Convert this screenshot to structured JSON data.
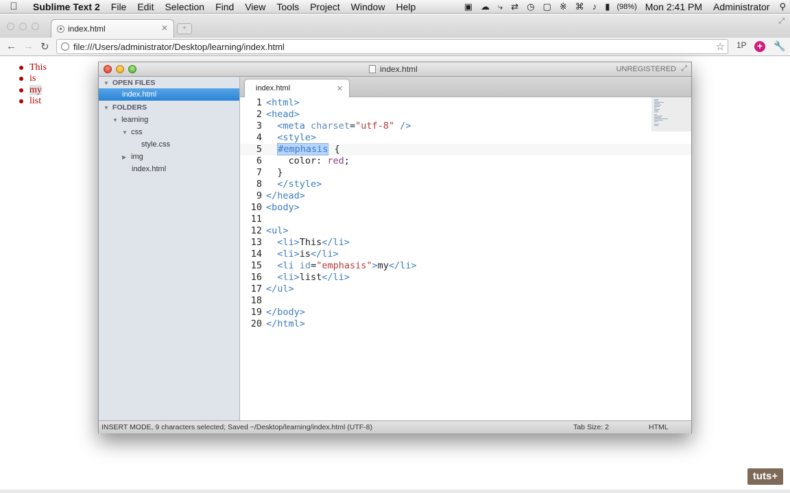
{
  "menubar": {
    "app": "Sublime Text 2",
    "items": [
      "File",
      "Edit",
      "Selection",
      "Find",
      "View",
      "Tools",
      "Project",
      "Window",
      "Help"
    ],
    "battery": "(98%)",
    "clock": "Mon 2:41 PM",
    "user": "Administrator"
  },
  "browser": {
    "tab_title": "index.html",
    "url": "file:///Users/administrator/Desktop/learning/index.html",
    "ext_label": "1P"
  },
  "page_list": [
    "This",
    "is",
    "my",
    "list"
  ],
  "sublime": {
    "window_title": "index.html",
    "unregistered": "UNREGISTERED",
    "tab_label": "index.html",
    "sidebar": {
      "open_files_header": "OPEN FILES",
      "open_file": "index.html",
      "folders_header": "FOLDERS",
      "tree": [
        "learning",
        "css",
        "style.css",
        "img",
        "index.html"
      ]
    },
    "line_numbers": [
      "1",
      "2",
      "3",
      "4",
      "5",
      "6",
      "7",
      "8",
      "9",
      "10",
      "11",
      "12",
      "13",
      "14",
      "15",
      "16",
      "17",
      "18",
      "19",
      "20"
    ],
    "status_left": "INSERT MODE, 9 characters selected; Saved ~/Desktop/learning/index.html (UTF-8)",
    "tab_size": "Tab Size: 2",
    "syntax": "HTML"
  },
  "watermark": "tuts+"
}
